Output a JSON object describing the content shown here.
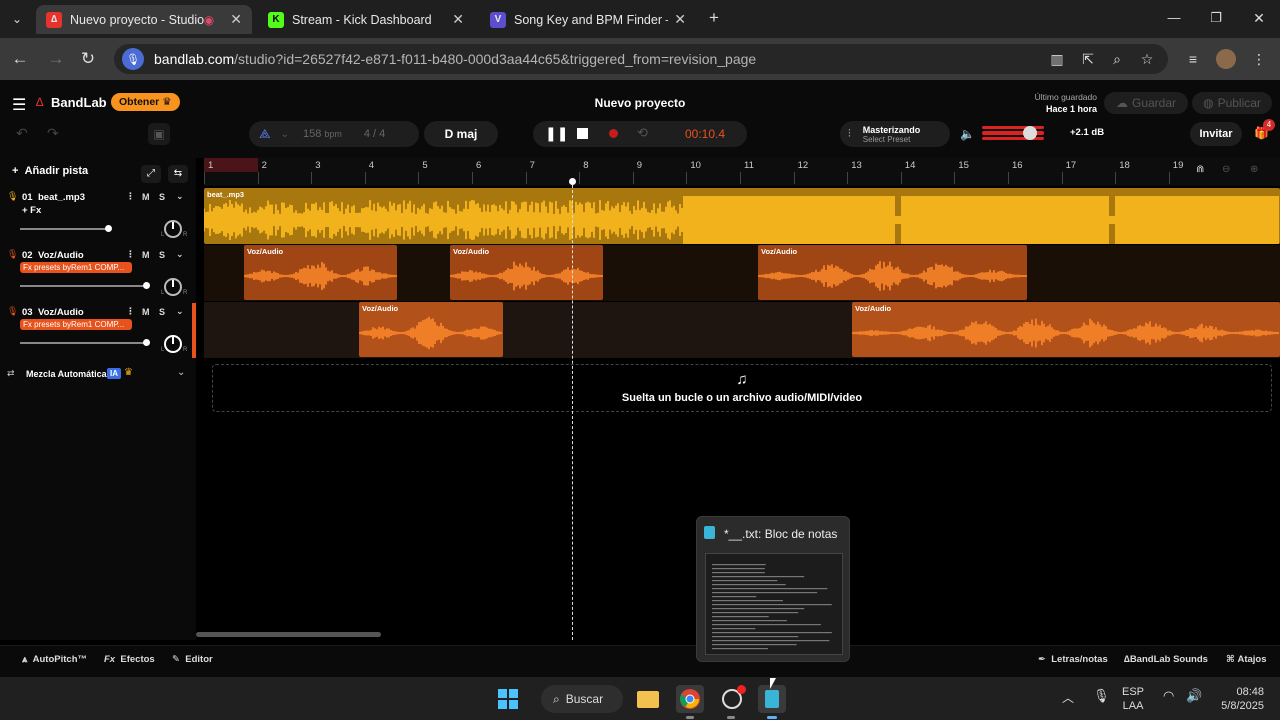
{
  "browser": {
    "tabs": [
      {
        "title": "Nuevo proyecto - Studio",
        "favicon_color": "#e8332c"
      },
      {
        "title": "Stream - Kick Dashboard",
        "favicon_color": "#53fc18"
      },
      {
        "title": "Song Key and BPM Finder — A",
        "favicon_color": "#5b4fcf"
      }
    ],
    "url_host": "bandlab.com",
    "url_rest": "/studio?id=26527f42-e871-f011-b480-000d3aa44c65&triggered_from=revision_page"
  },
  "header": {
    "brand": "BandLab",
    "obtener": "Obtener",
    "project_title": "Nuevo proyecto",
    "saved_label": "Último guardado",
    "saved_time": "Hace 1 hora",
    "guardar": "Guardar",
    "publicar": "Publicar",
    "bpm": "158",
    "bpm_unit": "bpm",
    "time_sig": "4 / 4",
    "key": "D maj",
    "time": "00:10.4",
    "mastering_title": "Masterizando",
    "mastering_sub": "Select Preset",
    "gain": "+2.1 dB",
    "invitar": "Invitar",
    "badge": "4"
  },
  "sidebar": {
    "add_track": "Añadir pista",
    "tracks": [
      {
        "num": "01",
        "name": "beat_.mp3",
        "fx": "+ Fx",
        "volume": 0.7
      },
      {
        "num": "02",
        "name": "Voz/Audio",
        "fx": "Fx presets byRem1 COMP...",
        "volume": 1.0
      },
      {
        "num": "03",
        "name": "Voz/Audio",
        "fx": "Fx presets byRem1 COMP...",
        "volume": 1.0
      }
    ],
    "mute": "M",
    "solo": "S",
    "pan_l": "L",
    "pan_r": "R",
    "auto_mix": "Mezcla Automática",
    "ia": "IA"
  },
  "ruler": {
    "bars": [
      "1",
      "2",
      "3",
      "4",
      "5",
      "6",
      "7",
      "8",
      "9",
      "10",
      "11",
      "12",
      "13",
      "14",
      "15",
      "16",
      "17",
      "18",
      "19"
    ]
  },
  "clips": {
    "beat": "beat_.mp3",
    "voz": "Voz/Audio"
  },
  "dropzone": {
    "text": "Suelta un bucle o un archivo audio/MIDI/video"
  },
  "bottom": {
    "autopitch": "AutoPitch™",
    "efectos": "Efectos",
    "editor": "Editor",
    "letras": "Letras/notas",
    "sounds": "BandLab Sounds",
    "atajos": "Atajos"
  },
  "preview": {
    "title": "*__.txt: Bloc de notas"
  },
  "taskbar": {
    "search": "Buscar",
    "lang1": "ESP",
    "lang2": "LAA",
    "time": "08:48",
    "date": "5/8/2025"
  },
  "colors": {
    "beat_clip": "#f2b21b",
    "voz_clip": "#d7641c",
    "accent_orange": "#e8521c",
    "obtener": "#f7931e"
  }
}
